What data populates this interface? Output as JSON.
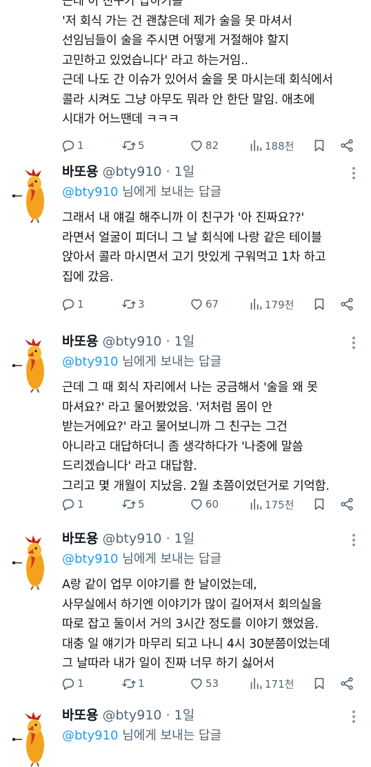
{
  "top_tweet": {
    "lines": "근데 이 친구가 답하기를\n'저 회식 가는 건 괜찮은데 제가 술을 못 마셔서\n선임님들이 술을 주시면 어떻게 거절해야 할지\n고민하고 있었습니다' 라고 하는거임..\n근데 나도 간 이슈가 있어서 술을 못 마시는데 회식에서\n콜라 시켜도 그냥 아무도 뭐라 안 한단 말임. 애초에\n시대가 어느땐데 ㅋㅋㅋ",
    "stats": {
      "replies": "1",
      "retweets": "5",
      "likes": "82",
      "views": "188천"
    }
  },
  "tweets": [
    {
      "name": "바또용",
      "handle": "@bty910",
      "dot": "·",
      "time": "1일",
      "reply_to": "@bty910",
      "reply_suffix": " 님에게 보내는 답글",
      "body": "그래서 내 얘길 해주니까 이 친구가 '아 진짜요??'\n라면서 얼굴이 피더니 그 날 회식에 나랑 같은 테이블\n앉아서 콜라 마시면서 고기 맛있게 구워먹고 1차 하고\n집에 갔음.",
      "stats": {
        "replies": "1",
        "retweets": "3",
        "likes": "67",
        "views": "179천"
      }
    },
    {
      "name": "바또용",
      "handle": "@bty910",
      "dot": "·",
      "time": "1일",
      "reply_to": "@bty910",
      "reply_suffix": " 님에게 보내는 답글",
      "body": "근데 그 때 회식 자리에서 나는 궁금해서 '술을 왜 못\n마셔요?' 라고 물어봤었음. '저처럼 몸이 안\n받는거에요?' 라고 물어보니까 그 친구는 그건\n아니라고 대답하더니 좀 생각하다가 '나중에 말씀\n드리겠습니다' 라고 대답함.\n그리고 몇 개월이 지났음. 2월 초쯤이었던거로 기억함.",
      "stats": {
        "replies": "1",
        "retweets": "5",
        "likes": "60",
        "views": "175천"
      }
    },
    {
      "name": "바또용",
      "handle": "@bty910",
      "dot": "·",
      "time": "1일",
      "reply_to": "@bty910",
      "reply_suffix": " 님에게 보내는 답글",
      "body": "A랑 같이 업무 이야기를 한 날이었는데,\n사무실에서 하기엔 이야기가 많이 길어져서 회의실을\n따로 잡고 둘이서 거의 3시간 정도를 이야기 했었음.\n대충 일 얘기가 마무리 되고 나니 4시 30분쯤이었는데\n그 날따라 내가 일이 진짜 너무 하기 싫어서",
      "stats": {
        "replies": "1",
        "retweets": "1",
        "likes": "53",
        "views": "171천"
      }
    },
    {
      "name": "바또용",
      "handle": "@bty910",
      "dot": "·",
      "time": "1일",
      "reply_to": "@bty910",
      "reply_suffix": " 님에게 보내는 답글"
    }
  ],
  "colors": {
    "accent": "#1d9bf0",
    "muted": "#536471",
    "text": "#0f1419"
  }
}
